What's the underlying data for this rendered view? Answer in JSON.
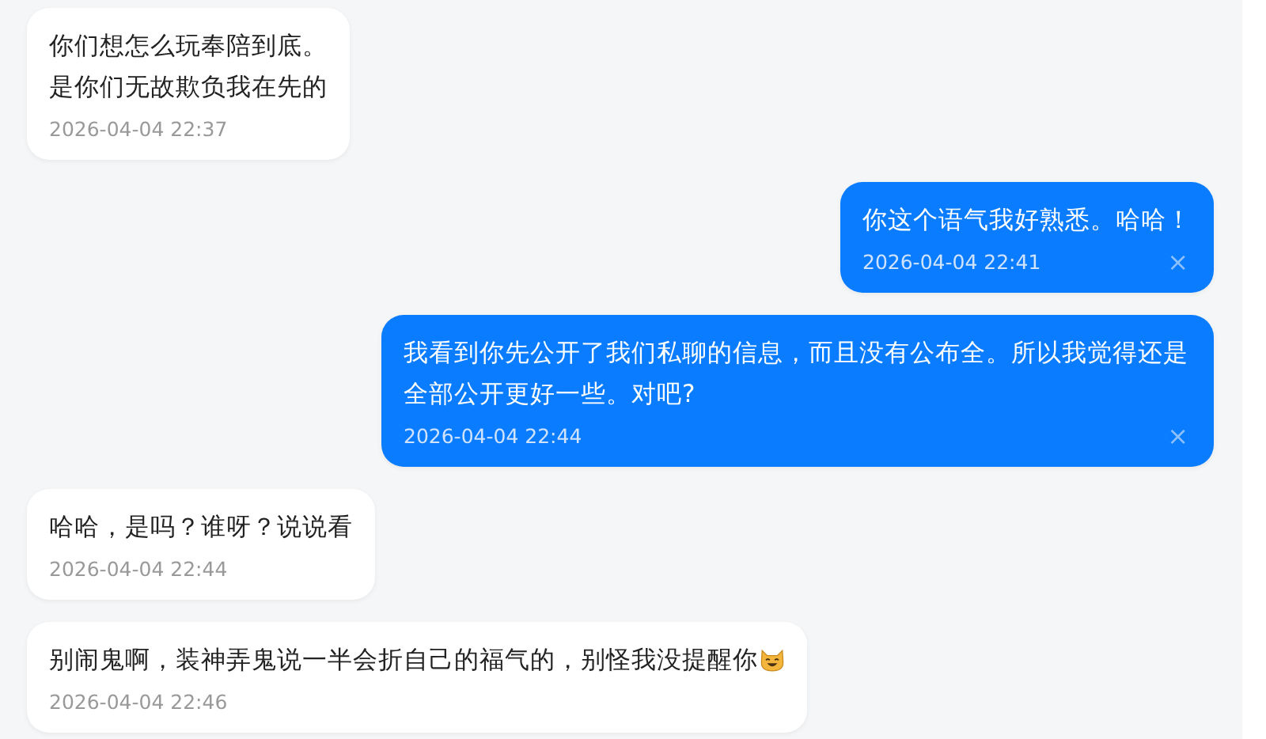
{
  "messages": [
    {
      "kind": "received",
      "lines": [
        "你们想怎么玩奉陪到底。",
        "是你们无故欺负我在先的"
      ],
      "time": "2026-04-04 22:37"
    },
    {
      "kind": "sent",
      "lines": [
        "你这个语气我好熟悉。哈哈！"
      ],
      "time": "2026-04-04 22:41",
      "delete": "×"
    },
    {
      "kind": "sent",
      "lines": [
        "我看到你先公开了我们私聊的信息，而且没有公布全。所以我觉得还是全部公开更好一些。对吧?"
      ],
      "time": "2026-04-04 22:44",
      "delete": "×"
    },
    {
      "kind": "received",
      "lines": [
        "哈哈，是吗？谁呀？说说看"
      ],
      "time": "2026-04-04 22:44"
    },
    {
      "kind": "received",
      "lines": [
        "别闹鬼啊，装神弄鬼说一半会折自己的福气的，别怪我没提醒你"
      ],
      "time": "2026-04-04 22:46",
      "emoji": true
    }
  ]
}
